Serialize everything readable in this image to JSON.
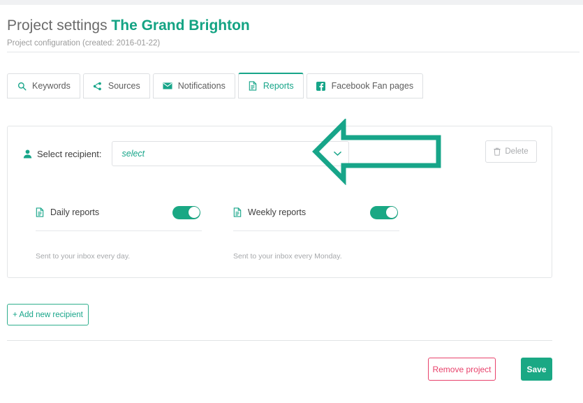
{
  "header": {
    "title_prefix": "Project settings",
    "project_name": "The Grand Brighton",
    "subtitle": "Project configuration (created: 2016-01-22)"
  },
  "tabs": [
    {
      "label": "Keywords",
      "icon": "search-icon",
      "active": false
    },
    {
      "label": "Sources",
      "icon": "share-icon",
      "active": false
    },
    {
      "label": "Notifications",
      "icon": "envelope-icon",
      "active": false
    },
    {
      "label": "Reports",
      "icon": "document-icon",
      "active": true
    },
    {
      "label": "Facebook Fan pages",
      "icon": "facebook-icon",
      "active": false
    }
  ],
  "recipient_card": {
    "label": "Select recipient:",
    "select_value": "select",
    "select_placeholder": "select",
    "delete_label": "Delete",
    "toggles": [
      {
        "label": "Daily reports",
        "state": "on",
        "note": "Sent to your inbox every day."
      },
      {
        "label": "Weekly reports",
        "state": "on",
        "note": "Sent to your inbox every Monday."
      }
    ]
  },
  "actions": {
    "add_recipient": "+ Add new recipient",
    "remove_project": "Remove project",
    "save": "Save"
  },
  "annotation": {
    "type": "left-pointing-arrow",
    "target": "select-recipient-field",
    "color": "#17a589"
  },
  "colors": {
    "accent_teal": "#17a589",
    "toggle_on": "#1aa884",
    "danger_pink": "#e8426b",
    "title_gray": "#6b6b6b",
    "muted_gray": "#9b9b9b"
  }
}
